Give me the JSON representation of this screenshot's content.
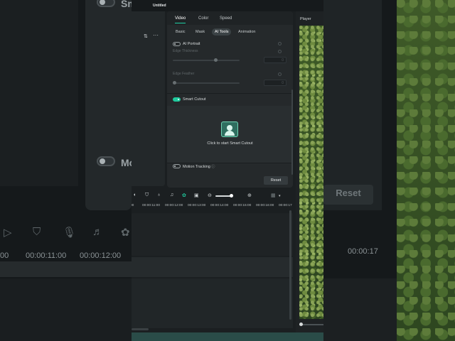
{
  "app": {
    "title": "Untitled"
  },
  "properties": {
    "main_tabs": [
      "Video",
      "Color",
      "Speed"
    ],
    "active_main_tab": "Video",
    "sub_tabs": [
      "Basic",
      "Mask",
      "AI Tools",
      "Animation"
    ],
    "active_sub_tab": "AI Tools",
    "ai_portrait": {
      "label": "AI Portrait",
      "enabled": false
    },
    "edge_thickness": {
      "label": "Edge Thickness",
      "value": "0"
    },
    "edge_feather": {
      "label": "Edge Feather",
      "value": "0"
    },
    "smart_cutout": {
      "label": "Smart Cutout",
      "enabled": true,
      "prompt": "Click to start Smart Cutout"
    },
    "motion_tracking": {
      "label": "Motion Tracking",
      "enabled": false,
      "help_icon": "help-icon"
    },
    "reset_label": "Reset"
  },
  "player": {
    "title": "Player"
  },
  "timeline": {
    "ruler": [
      "00:00:11:00",
      "00:00:12:00",
      "00:00:13:00",
      "00:00:14:00",
      "00:00:15:00",
      "00:00:16:00",
      "00:00:17"
    ]
  },
  "backdrop": {
    "left_label_1": "Sm",
    "left_label_2": "Mo",
    "left_ruler_1": "00",
    "left_ruler_2": "00:00:11:00",
    "left_ruler_3": "00:00:12:00",
    "right_reset": "Reset",
    "right_ruler": "00:00:17"
  },
  "colors": {
    "accent": "#1fc99c",
    "panel": "#25292b",
    "background": "#1b1f21"
  }
}
